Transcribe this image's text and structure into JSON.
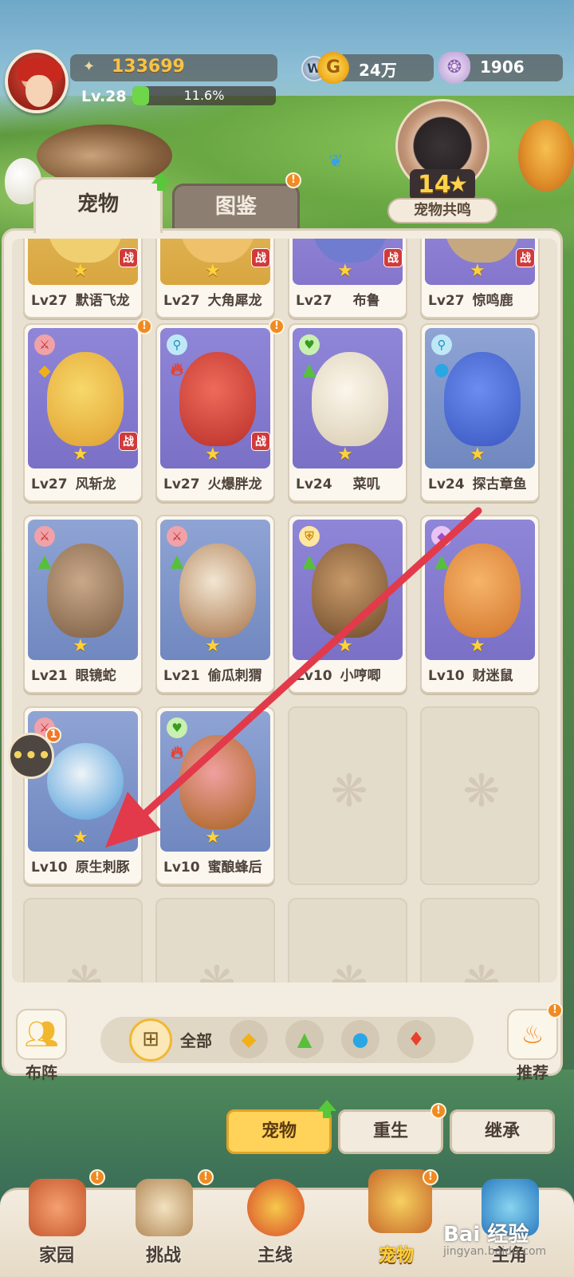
{
  "player": {
    "power": "133699",
    "level": "Lv.28",
    "exp_text": "11.6%",
    "exp_progress": 0.116
  },
  "currency": {
    "gold": "24万",
    "shell": "1906"
  },
  "resonance": {
    "count": "14",
    "star": "★",
    "label": "宠物共鸣"
  },
  "tabs": [
    {
      "label": "宠物"
    },
    {
      "label": "图鉴"
    }
  ],
  "pets": [
    {
      "level": "Lv27",
      "name": "默语飞龙"
    },
    {
      "level": "Lv27",
      "name": "大角犀龙"
    },
    {
      "level": "Lv27",
      "name": "布鲁"
    },
    {
      "level": "Lv27",
      "name": "惊鸣鹿"
    },
    {
      "level": "Lv27",
      "name": "风斩龙"
    },
    {
      "level": "Lv27",
      "name": "火爆胖龙"
    },
    {
      "level": "Lv24",
      "name": "菜叽"
    },
    {
      "level": "Lv24",
      "name": "探古章鱼"
    },
    {
      "level": "Lv21",
      "name": "眼镜蛇"
    },
    {
      "level": "Lv21",
      "name": "偷瓜刺猬"
    },
    {
      "level": "Lv10",
      "name": "小哼唧"
    },
    {
      "level": "Lv10",
      "name": "财迷鼠"
    },
    {
      "level": "Lv10",
      "name": "原生刺豚"
    },
    {
      "level": "Lv10",
      "name": "蜜酿蜂后"
    }
  ],
  "card": {
    "star": "★",
    "battle_tag": "战"
  },
  "chat": {
    "badge": "1"
  },
  "filter": {
    "lineup_label": "布阵",
    "all_label": "全部",
    "recommend_label": "推荐"
  },
  "actions": [
    {
      "label": "宠物"
    },
    {
      "label": "重生"
    },
    {
      "label": "继承"
    }
  ],
  "nav": [
    {
      "label": "家园"
    },
    {
      "label": "挑战"
    },
    {
      "label": "主线"
    },
    {
      "label": "宠物"
    },
    {
      "label": "主角"
    }
  ],
  "watermark": {
    "logo": "Bai 经验",
    "url": "jingyan.baidu.com"
  },
  "colors": {
    "accent": "#ffd25a",
    "notification": "#f08a22",
    "arrow": "#e23a4a"
  }
}
